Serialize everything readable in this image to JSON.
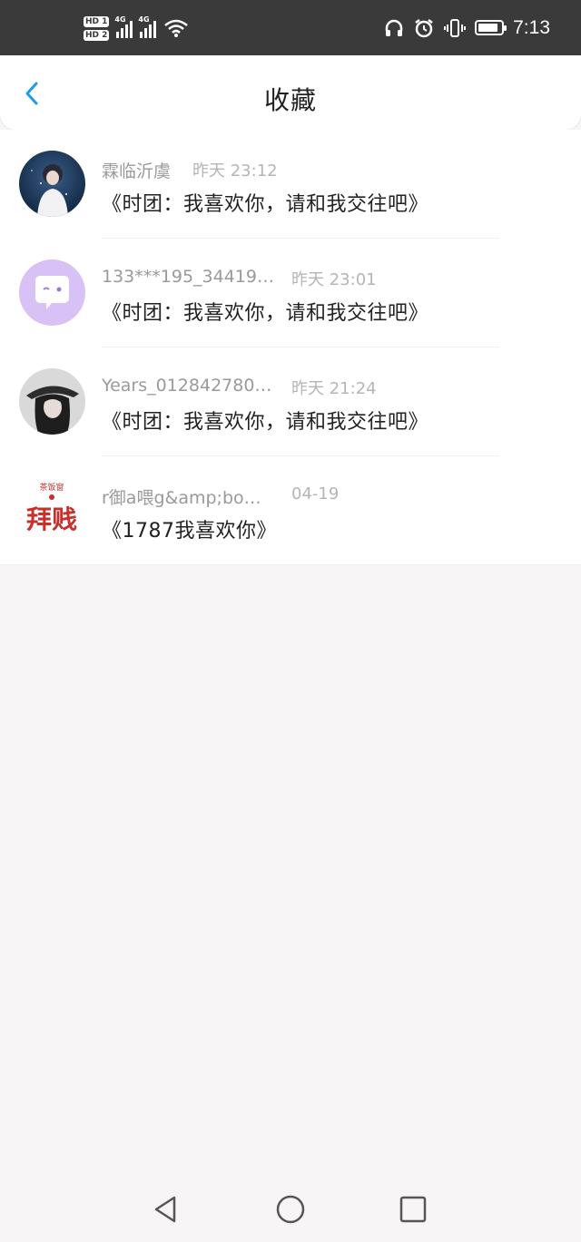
{
  "status_bar": {
    "hd1": "HD 1",
    "hd2": "HD 2",
    "net1": "4G",
    "net2": "4G",
    "time": "7:13",
    "icons": [
      "headphones-icon",
      "alarm-icon",
      "vibrate-icon",
      "battery-icon"
    ]
  },
  "header": {
    "title": "收藏",
    "back_icon": "chevron-left-icon"
  },
  "items": [
    {
      "user": "霖临沂虞",
      "time": "昨天 23:12",
      "title": "《时团：我喜欢你，请和我交往吧》"
    },
    {
      "user": "133***195_34419…",
      "time": "昨天 23:01",
      "title": "《时团：我喜欢你，请和我交往吧》"
    },
    {
      "user": "Years_012842780…",
      "time": "昨天 21:24",
      "title": "《时团：我喜欢你，请和我交往吧》"
    },
    {
      "user": "r御a喂g&amp;bo…",
      "time": "04-19",
      "title": "《1787我喜欢你》"
    }
  ],
  "avatar_logo_text": {
    "top": "茶饭窗",
    "main": "拜贱"
  },
  "nav": {
    "back": "triangle-back-icon",
    "home": "circle-home-icon",
    "recents": "square-recents-icon"
  },
  "colors": {
    "accent": "#1e9be6",
    "status_bar": "#3a3a3a",
    "background": "#f7f5f6"
  }
}
